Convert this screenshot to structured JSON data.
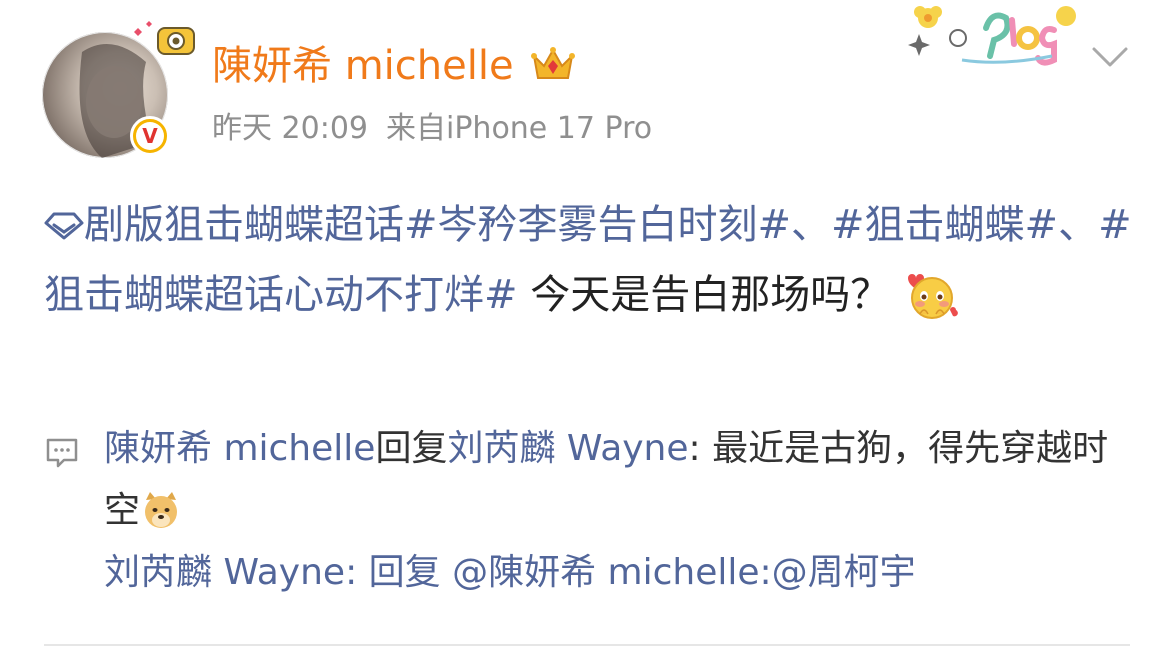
{
  "post": {
    "user_name": "陳妍希 michelle",
    "time": "昨天 20:09",
    "source": "来自iPhone 17 Pro",
    "topic_1": "剧版狙击蝴蝶超话#岑矜李雾告白时刻#",
    "sep_1": "、",
    "topic_2": "#狙击蝴蝶#",
    "sep_2": "、",
    "topic_3": "#狙击蝴蝶超话心动不打烊#",
    "body": " 今天是告白那场吗？"
  },
  "comments": [
    {
      "name": "陳妍希 michelle",
      "reply_word": "回复",
      "reply_to": "刘芮麟 Wayne",
      "text": ": 最近是古狗，得先穿越时空"
    },
    {
      "name": "刘芮麟 Wayne",
      "text": ": 回复 @陳妍希 michelle:@周柯宇"
    }
  ],
  "colors": {
    "name": "#f07a1a",
    "link": "#52669a",
    "meta": "#8f8f8f"
  },
  "icons": [
    "avatar",
    "verified-badge-icon",
    "crown-icon",
    "plog-sticker",
    "chevron-down-icon",
    "topic-icon",
    "blush-emoji",
    "comment-icon",
    "doge-emoji"
  ]
}
